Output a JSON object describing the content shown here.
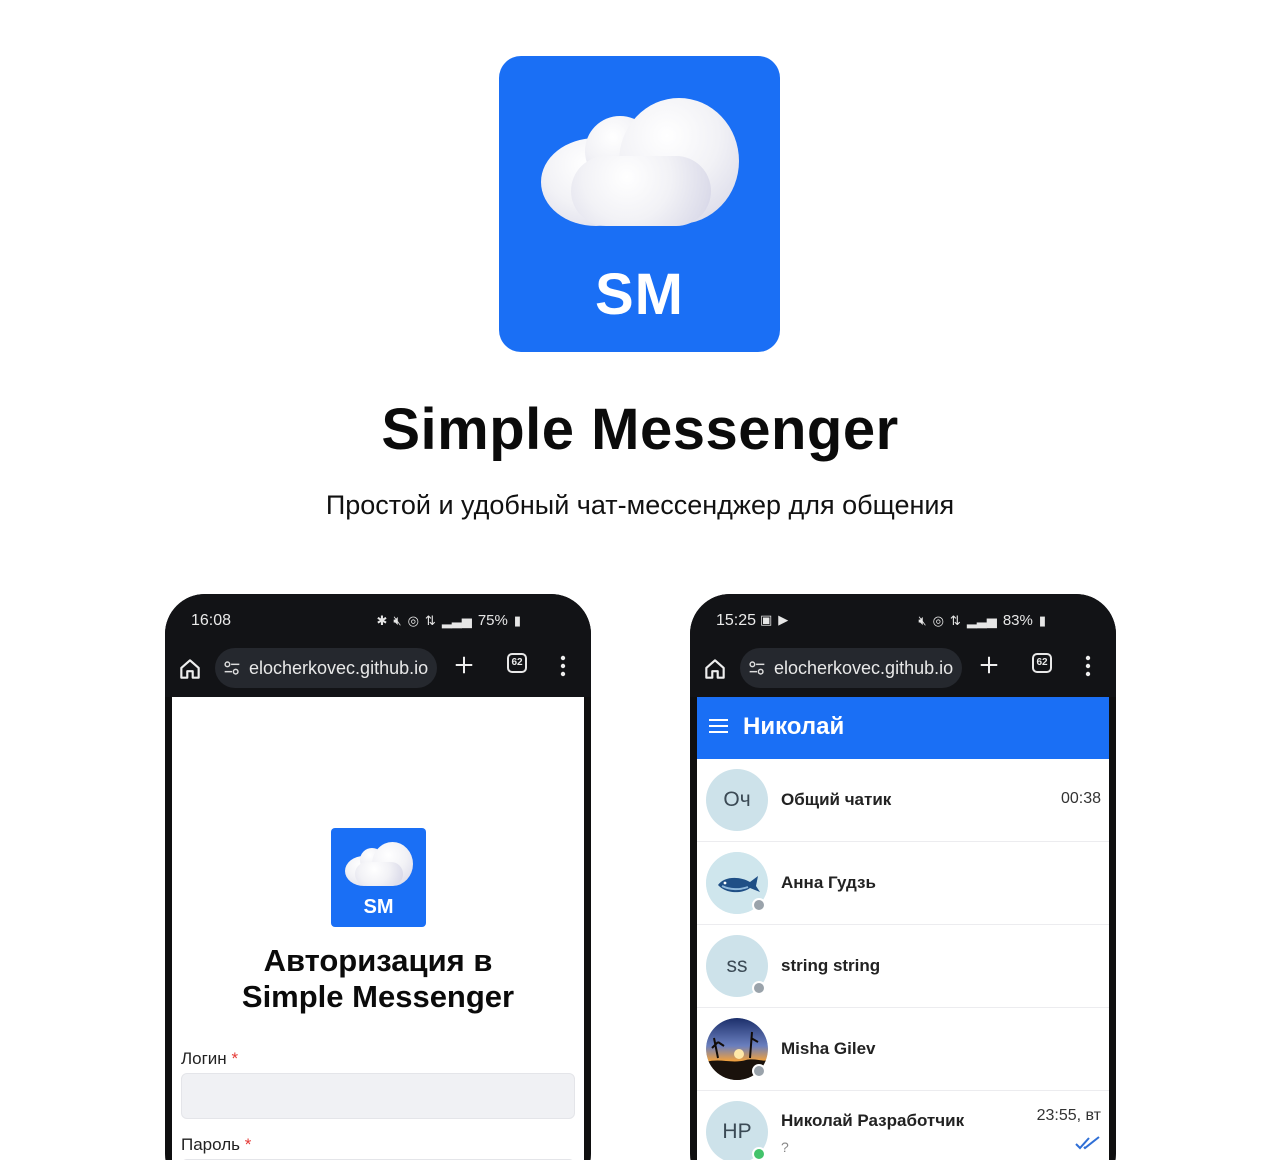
{
  "colors": {
    "brand": "#1a6ff5",
    "status_bar": "#121316",
    "online": "#43c36b",
    "offline": "#9aa3ab"
  },
  "hero": {
    "icon_label": "SM",
    "title": "Simple Messenger",
    "subtitle": "Простой и удобный чат-мессенджер для общения"
  },
  "phone_left": {
    "status": {
      "time": "16:08",
      "battery": "75%"
    },
    "browser": {
      "url": "elocherkovec.github.io",
      "tab_count": "62"
    },
    "login": {
      "icon_label": "SM",
      "title_line1": "Авторизация в",
      "title_line2": "Simple Messenger",
      "login_label": "Логин",
      "password_label": "Пароль",
      "required_mark": "*"
    }
  },
  "phone_right": {
    "status": {
      "time": "15:25",
      "battery": "83%"
    },
    "browser": {
      "url": "elocherkovec.github.io",
      "tab_count": "62"
    },
    "app_bar": {
      "title": "Николай"
    },
    "chats": [
      {
        "initials": "Оч",
        "name": "Общий чатик",
        "time": "00:38",
        "preview": "",
        "presence": "none",
        "avatar_type": "initials"
      },
      {
        "initials": "",
        "name": "Анна Гудзь",
        "time": "",
        "preview": "",
        "presence": "offline",
        "avatar_type": "whale-image"
      },
      {
        "initials": "ss",
        "name": "string string",
        "time": "",
        "preview": "",
        "presence": "offline",
        "avatar_type": "initials"
      },
      {
        "initials": "",
        "name": "Misha Gilev",
        "time": "",
        "preview": "",
        "presence": "offline",
        "avatar_type": "sunset-image"
      },
      {
        "initials": "НР",
        "name": "Николай Разработчик",
        "time": "23:55, вт",
        "preview": "?",
        "presence": "online",
        "avatar_type": "initials",
        "read": true
      }
    ]
  }
}
